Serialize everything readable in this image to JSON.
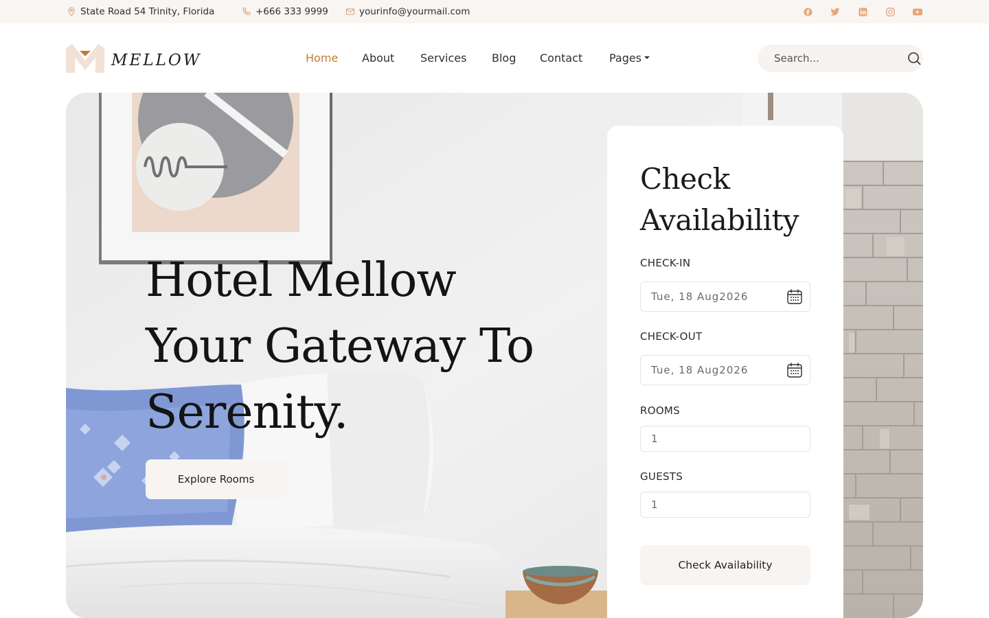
{
  "topbar": {
    "address": "State Road 54 Trinity, Florida",
    "phone": "+666 333 9999",
    "email": "yourinfo@yourmail.com",
    "social_icons": [
      "facebook-icon",
      "twitter-icon",
      "linkedin-icon",
      "instagram-icon",
      "youtube-icon"
    ]
  },
  "brand": {
    "name": "MELLOW",
    "accent_color": "#c77a2c",
    "logo_light_color": "#f2e1d6"
  },
  "nav": {
    "items": [
      {
        "label": "Home",
        "active": true
      },
      {
        "label": "About",
        "active": false
      },
      {
        "label": "Services",
        "active": false
      },
      {
        "label": "Blog",
        "active": false
      },
      {
        "label": "Contact",
        "active": false
      },
      {
        "label": "Pages",
        "active": false,
        "has_dropdown": true
      }
    ]
  },
  "search": {
    "placeholder": "Search..."
  },
  "hero": {
    "title": "Hotel Mellow Your Gateway To Serenity.",
    "cta_label": "Explore Rooms"
  },
  "booking": {
    "title": "Check Availability",
    "checkin_label": "CHECK-IN",
    "checkin_value": "Tue, 18 Aug2026",
    "checkout_label": "CHECK-OUT",
    "checkout_value": "Tue, 18 Aug2026",
    "rooms_label": "ROOMS",
    "rooms_value": "1",
    "guests_label": "GUESTS",
    "guests_value": "1",
    "submit_label": "Check Availability"
  }
}
